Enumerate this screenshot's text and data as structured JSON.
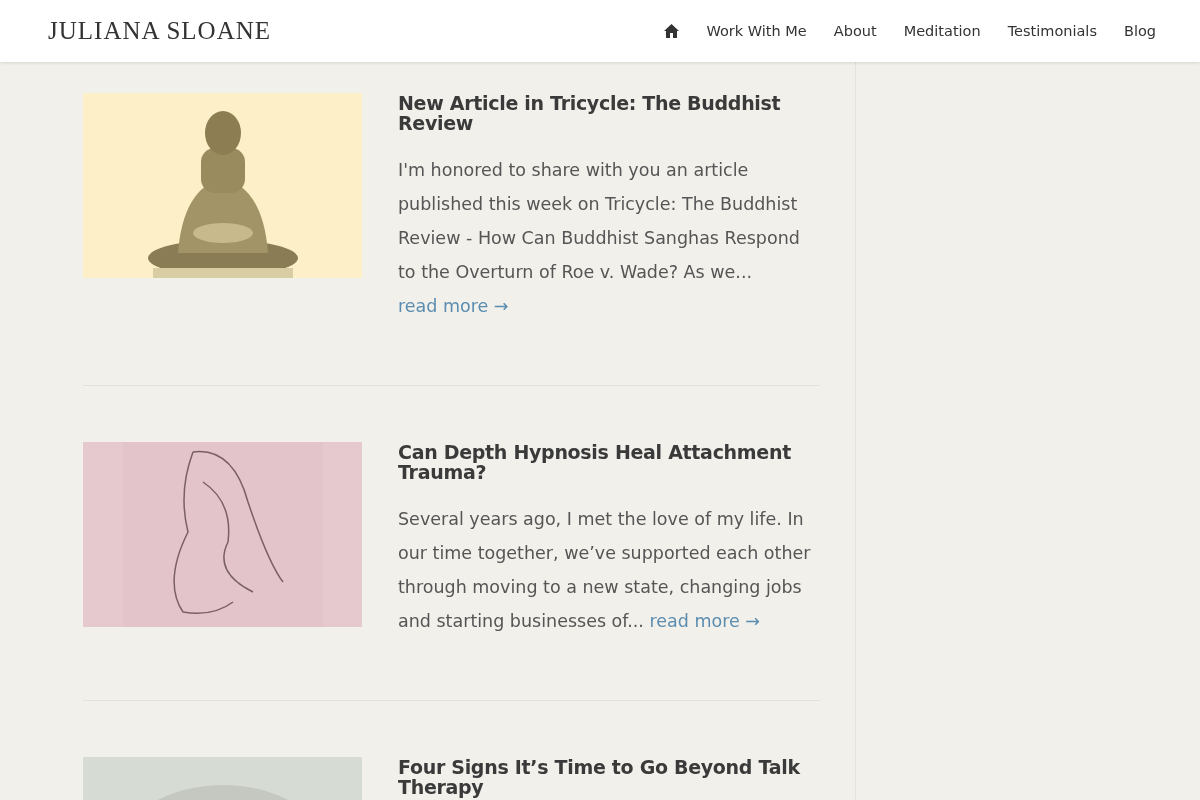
{
  "header": {
    "logo": "JULIANA SLOANE",
    "nav": [
      {
        "kind": "home"
      },
      {
        "kind": "link",
        "label": "Work With Me"
      },
      {
        "kind": "link",
        "label": "About"
      },
      {
        "kind": "link",
        "label": "Meditation"
      },
      {
        "kind": "link",
        "label": "Testimonials"
      },
      {
        "kind": "link",
        "label": "Blog"
      }
    ]
  },
  "posts": [
    {
      "title": "New Article in Tricycle: The Buddhist Review",
      "excerpt": "I'm honored to share with you an article published this week on Tricycle: The Buddhist Review - How Can Buddhist Sanghas Respond to the Overturn of Roe v. Wade? As we...",
      "link": "read more →"
    },
    {
      "title": "Can Depth Hypnosis Heal Attachment Trauma?",
      "excerpt": "Several years ago, I met the love of my life. In our time together, we’ve supported each other through moving to a new state, changing jobs and starting businesses of...",
      "link": "read more →"
    },
    {
      "title": "Four Signs It’s Time to Go Beyond Talk Therapy"
    }
  ]
}
